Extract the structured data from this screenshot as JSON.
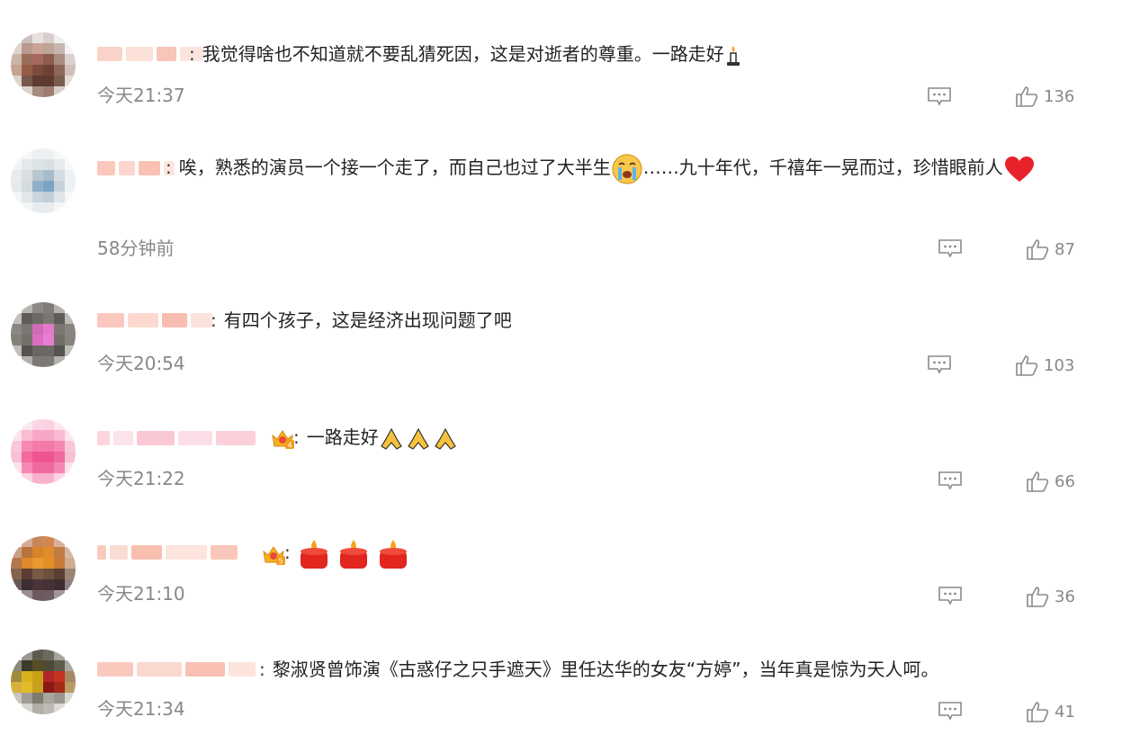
{
  "comments": [
    {
      "text": "我觉得啥也不知道就不要乱猜死因，这是对逝者的尊重。一路走好",
      "emoji": "candle-icon",
      "time": "今天21:37",
      "likes": "136",
      "avatar": [
        "#f0eeee",
        "#c9c0bf",
        "#e6e1e0",
        "#d8cfcd",
        "#f0eeee",
        "#ffffff",
        "#ddd5d2",
        "#b89a8e",
        "#caa597",
        "#bda596",
        "#c8b7b1",
        "#f3f1f1",
        "#cbb4a7",
        "#9b6e5a",
        "#a5695e",
        "#8d5c4e",
        "#a98d82",
        "#ddd1cd",
        "#c5a391",
        "#935e45",
        "#7c4a3d",
        "#6d4136",
        "#8c6858",
        "#cfc0b8",
        "#dcd4cf",
        "#78584a",
        "#5e3a30",
        "#5d3b2f",
        "#7b5c50",
        "#e6ddd9",
        "#ffffff",
        "#dbd2cd",
        "#a68b80",
        "#9c7e72",
        "#d9cfca",
        "#ffffff"
      ],
      "name": [
        "#fad4c8",
        "#fbe0d8",
        "#f7c5ba",
        "#fbe4dd"
      ]
    },
    {
      "text": "唉，熟悉的演员一个接一个走了，而自己也过了大半生",
      "text2": "……九十年代，千禧年一晃而过，珍惜眼前人",
      "time": "58分钟前",
      "likes": "87",
      "avatar": [
        "#ffffff",
        "#f4f6f7",
        "#edf0f2",
        "#eef1f2",
        "#f6f7f8",
        "#ffffff",
        "#f3f4f5",
        "#e4e8ea",
        "#dce2e5",
        "#d9e0e4",
        "#e6eaec",
        "#f7f8f9",
        "#e7ebed",
        "#d9dfe2",
        "#b9c7d0",
        "#a7bccb",
        "#d5dde2",
        "#eef1f3",
        "#e5e9eb",
        "#d3dbe0",
        "#8fb0c9",
        "#7aa4c4",
        "#c6d3dc",
        "#eef1f3",
        "#f3f5f6",
        "#e1e6e9",
        "#c9d4dc",
        "#c2cfd8",
        "#dfe5e8",
        "#f7f8f9",
        "#ffffff",
        "#f2f4f5",
        "#e8ecee",
        "#e8ecee",
        "#f5f6f7",
        "#ffffff"
      ],
      "name": [
        "#fac8bd",
        "#fbd7ce",
        "#f9c0b3",
        "#fde6df"
      ]
    },
    {
      "text": "有四个孩子，这是经济出现问题了吧",
      "time": "今天20:54",
      "likes": "103",
      "avatar": [
        "#ffffff",
        "#b9b5b1",
        "#8d8a86",
        "#7f7d79",
        "#b5b2ae",
        "#ffffff",
        "#c3bfbb",
        "#5f5d5a",
        "#6c6a66",
        "#7a7773",
        "#5e5c59",
        "#bfbcb8",
        "#8a8783",
        "#7a7773",
        "#d06bb6",
        "#e479cc",
        "#7a7773",
        "#888581",
        "#838079",
        "#74716d",
        "#dc6ec2",
        "#e87ed1",
        "#716e6a",
        "#86837f",
        "#c1bdb9",
        "#55524f",
        "#6a6763",
        "#6c6965",
        "#55534f",
        "#c0bcb8",
        "#ffffff",
        "#b4b0ac",
        "#7d7a76",
        "#7d7a76",
        "#b4b0ac",
        "#ffffff"
      ],
      "name": [
        "#fbc8bf",
        "#fcd8d0",
        "#f9bcb1",
        "#fce2dc"
      ]
    },
    {
      "text": "一路走好",
      "badge": "4",
      "emoji": "pray-icon",
      "time": "今天21:22",
      "likes": "66",
      "avatar": [
        "#ffffff",
        "#fde7ef",
        "#fbd5e3",
        "#fbd2e1",
        "#fde6ee",
        "#ffffff",
        "#fde3ec",
        "#f9bcd3",
        "#f7a8c6",
        "#f7a6c5",
        "#f9bad1",
        "#fde4ed",
        "#fac7da",
        "#f589b3",
        "#f47aa9",
        "#f478a8",
        "#f587b2",
        "#fac7da",
        "#f9bfd4",
        "#f16b9f",
        "#ee5591",
        "#ee5491",
        "#f0699e",
        "#f9bfd4",
        "#fde2ec",
        "#f488b2",
        "#f06a9f",
        "#f0699e",
        "#f487b1",
        "#fde2ec",
        "#ffffff",
        "#fbd3e2",
        "#f8b1cb",
        "#f8b1cb",
        "#fbd3e2",
        "#ffffff"
      ],
      "name": [
        "#fdd5de",
        "#fce3e9",
        "#fac8d4",
        "#fcdfe6",
        "#fbd0da"
      ]
    },
    {
      "text": "",
      "badge": "5",
      "emoji": "candle-red-icon",
      "time": "今天21:10",
      "likes": "36",
      "avatar": [
        "#ffffff",
        "#d4ab94",
        "#c9865a",
        "#d1884f",
        "#d9b199",
        "#ffffff",
        "#caa082",
        "#b9733c",
        "#d88327",
        "#e08c2a",
        "#c07c45",
        "#d9b7a0",
        "#b3774c",
        "#dd8a2a",
        "#e89a31",
        "#e58f28",
        "#c87a37",
        "#cfab91",
        "#84624f",
        "#5a3e33",
        "#7a5a46",
        "#6e4f3e",
        "#5b4032",
        "#9a8475",
        "#695757",
        "#3d2d33",
        "#4a3438",
        "#463236",
        "#3d2c31",
        "#8f8080",
        "#ffffff",
        "#9b8d91",
        "#6a5a60",
        "#6d5c62",
        "#a3969a",
        "#ffffff"
      ],
      "name": [
        "#f9cbbd",
        "#fbdcd2",
        "#f8bfaf",
        "#fde4dc",
        "#f9c8b9"
      ]
    },
    {
      "text": "黎淑贤曾饰演《古惑仔之只手遮天》里任达华的女友“方婷”，当年真是惊为天人呵。",
      "time": "今天21:34",
      "likes": "41",
      "avatar": [
        "#ffffff",
        "#9a9890",
        "#5d5b4e",
        "#6b6a5f",
        "#a5a39d",
        "#ffffff",
        "#8d8a7c",
        "#3b3a2b",
        "#574c24",
        "#4c4a36",
        "#5f5c4d",
        "#a9a7a0",
        "#a08b3d",
        "#d7b21b",
        "#c9a116",
        "#b2262a",
        "#c4331f",
        "#a88765",
        "#d6b13c",
        "#e2bb2a",
        "#c9a020",
        "#8a1914",
        "#a22b19",
        "#b99a62",
        "#c8c6c0",
        "#9f9d95",
        "#7e7b6f",
        "#a8a59b",
        "#9a978e",
        "#d9d8d3",
        "#ffffff",
        "#d6d5cf",
        "#b0aea5",
        "#bcbab2",
        "#dcdbd6",
        "#ffffff"
      ],
      "name": [
        "#fac9bd",
        "#fbd8cf",
        "#f9c1b4",
        "#fde3dc"
      ]
    }
  ]
}
